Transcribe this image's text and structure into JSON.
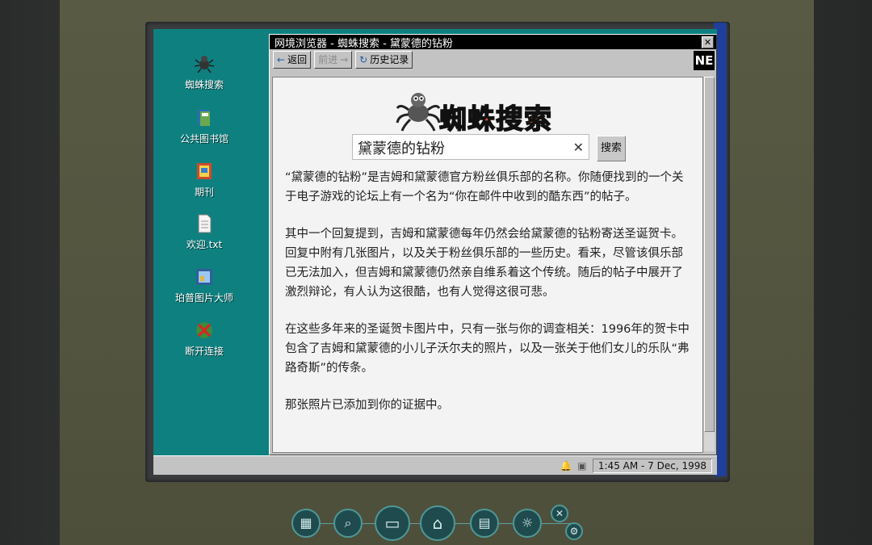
{
  "window": {
    "title": "网境浏览器 - 蜘蛛搜索 - 黛蒙德的钻粉",
    "close_glyph": "✕",
    "toolbar": {
      "back_label": "返回",
      "forward_label": "前进",
      "history_label": "历史记录"
    },
    "logo_badge": "NE"
  },
  "desktop_icons": [
    {
      "label": "蜘蛛搜索",
      "icon": "spider-icon"
    },
    {
      "label": "公共图书馆",
      "icon": "book-icon"
    },
    {
      "label": "期刊",
      "icon": "magazine-icon"
    },
    {
      "label": "欢迎.txt",
      "icon": "text-file-icon"
    },
    {
      "label": "珀普图片大师",
      "icon": "image-editor-icon"
    },
    {
      "label": "断开连接",
      "icon": "disconnect-icon"
    }
  ],
  "search": {
    "logo_text": "蜘蛛搜索",
    "query": "黛蒙德的钻粉",
    "button_label": "搜索",
    "clear_glyph": "✕"
  },
  "article": {
    "paragraphs": [
      "“黛蒙德的钻粉”是吉姆和黛蒙德官方粉丝俱乐部的名称。你随便找到的一个关于电子游戏的论坛上有一个名为“你在邮件中收到的酷东西”的帖子。",
      "其中一个回复提到，吉姆和黛蒙德每年仍然会给黛蒙德的钻粉寄送圣诞贺卡。回复中附有几张图片，以及关于粉丝俱乐部的一些历史。看来，尽管该俱乐部已无法加入，但吉姆和黛蒙德仍然亲自维系着这个传统。随后的帖子中展开了激烈辩论，有人认为这很酷，也有人觉得这很可悲。",
      "在这些多年来的圣诞贺卡图片中，只有一张与你的调查相关：1996年的贺卡中包含了吉姆和黛蒙德的小儿子沃尔夫的照片，以及一张关于他们女儿的乐队“弗路奇斯”的传条。",
      "那张照片已添加到你的证据中。"
    ]
  },
  "taskbar": {
    "clock": "1:45 AM - 7 Dec, 1998"
  },
  "dock": {
    "items": [
      "board-icon",
      "magnifier-icon",
      "computer-icon",
      "home-icon",
      "notebook-icon",
      "hint-icon",
      "settings-icon"
    ]
  }
}
